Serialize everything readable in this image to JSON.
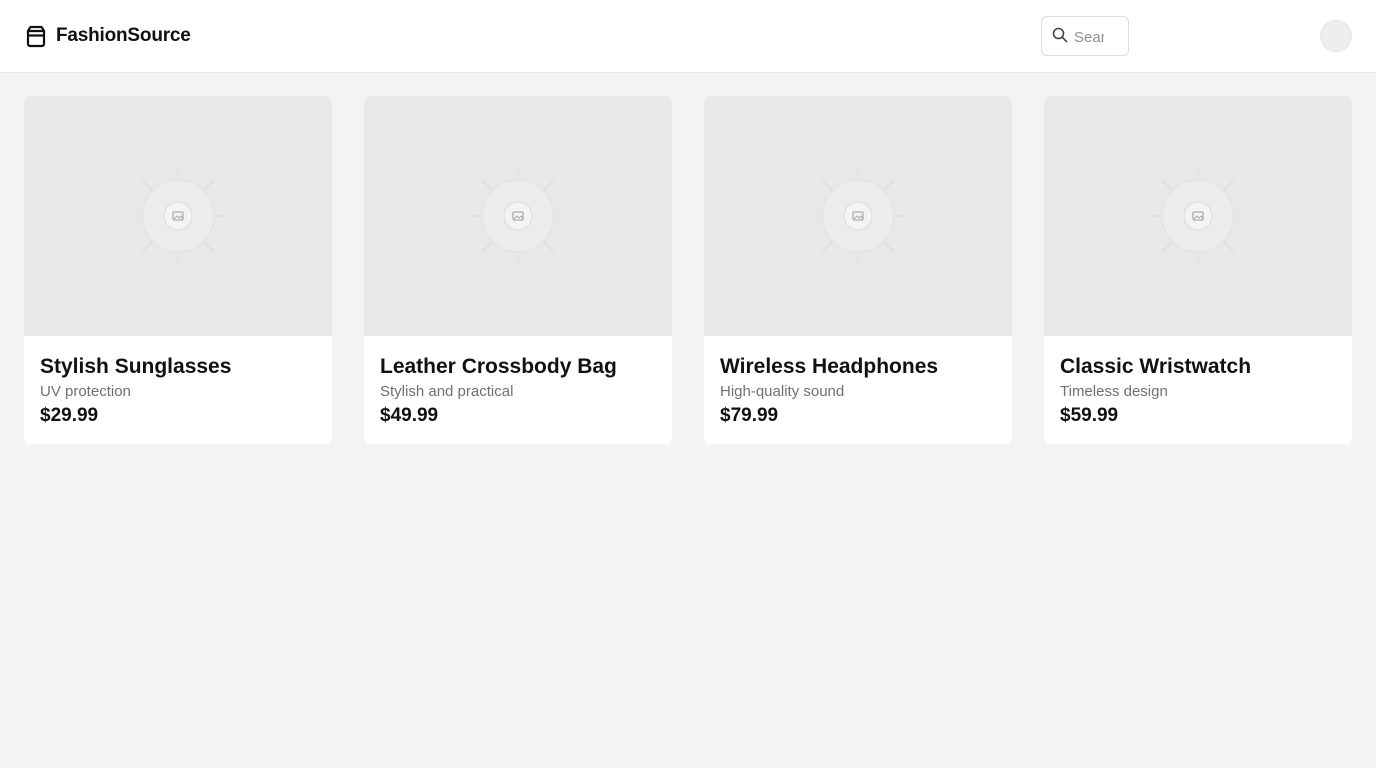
{
  "header": {
    "brand_name": "FashionSource",
    "brand_icon": "shopping-bag-icon",
    "search": {
      "placeholder": "Search",
      "value": "",
      "icon": "search-icon"
    },
    "avatar_icon": "user-avatar"
  },
  "products": [
    {
      "title": "Stylish Sunglasses",
      "description": "UV protection",
      "price": "$29.99",
      "image_icon": "image-placeholder-icon"
    },
    {
      "title": "Leather Crossbody Bag",
      "description": "Stylish and practical",
      "price": "$49.99",
      "image_icon": "image-placeholder-icon"
    },
    {
      "title": "Wireless Headphones",
      "description": "High-quality sound",
      "price": "$79.99",
      "image_icon": "image-placeholder-icon"
    },
    {
      "title": "Classic Wristwatch",
      "description": "Timeless design",
      "price": "$59.99",
      "image_icon": "image-placeholder-icon"
    }
  ],
  "colors": {
    "page_background": "#f2f3f5",
    "header_background": "#ffffff",
    "card_background": "#ffffff",
    "image_placeholder": "#e8e8e8",
    "text_primary": "#111111",
    "text_secondary": "#6b7079"
  }
}
